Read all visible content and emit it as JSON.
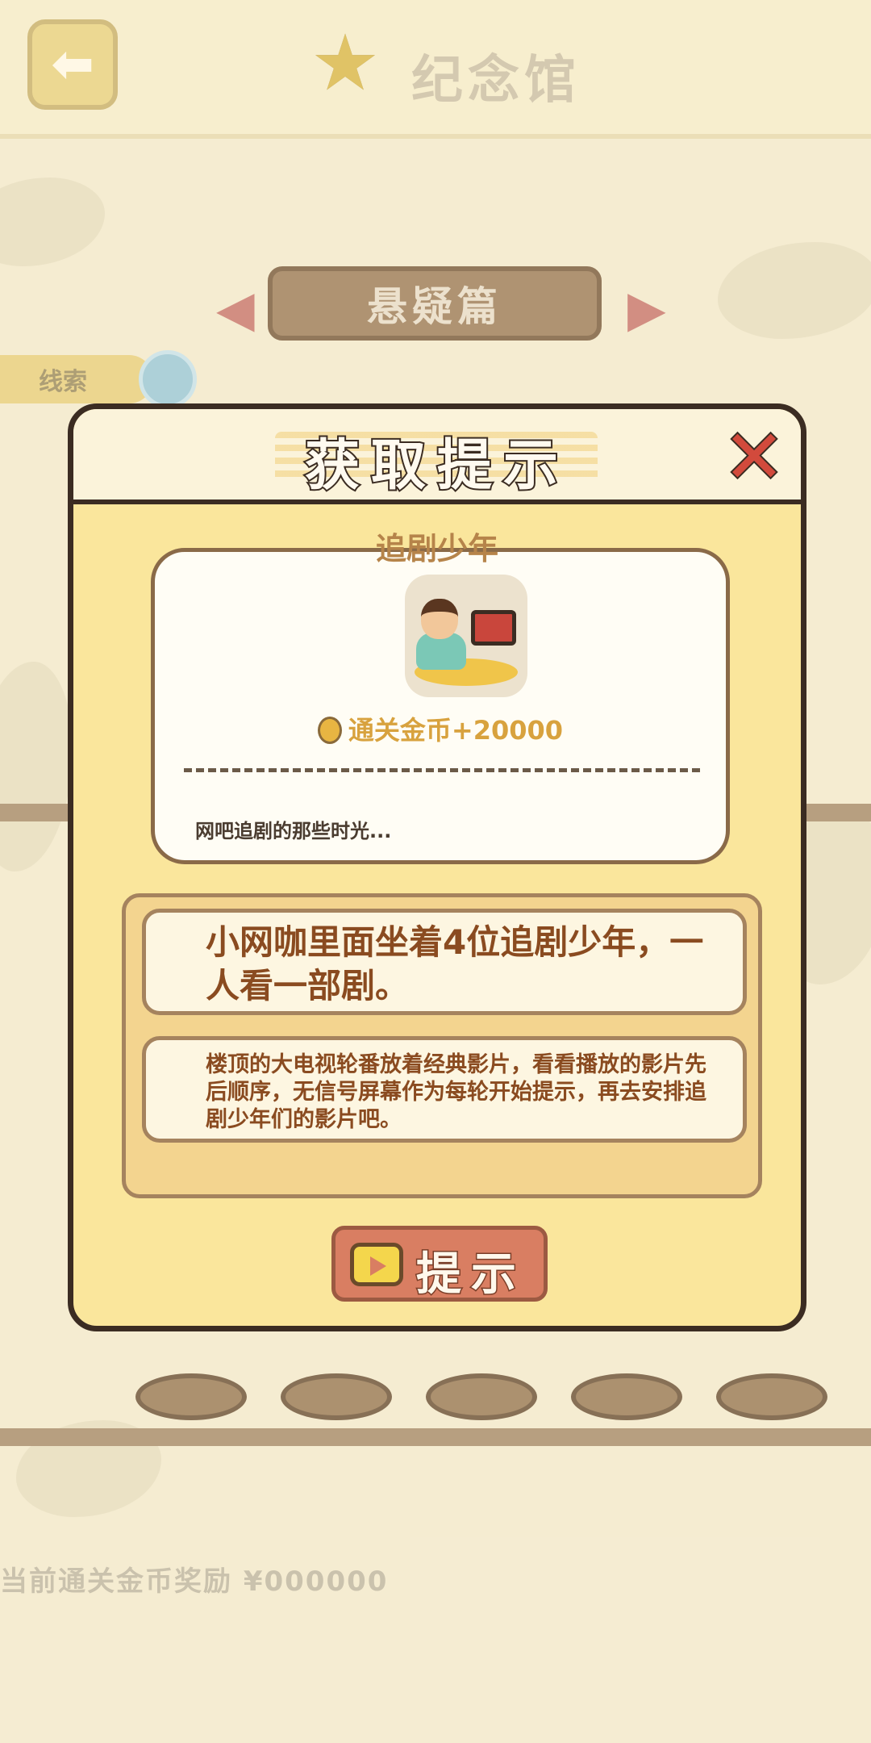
{
  "background": {
    "title": "纪念馆",
    "chapter": "悬疑篇",
    "side_tag": "线索",
    "bottom_text": "当前通关金币奖励 ¥000000"
  },
  "modal": {
    "title": "获取提示",
    "item_name": "追剧少年",
    "reward": "通关金币+20000",
    "description": "网吧追剧的那些时光...",
    "hint_main": "小网咖里面坐着4位追剧少年，一人看一部剧。",
    "hint_detail": "楼顶的大电视轮番放着经典影片，看看播放的影片先后顺序，无信号屏幕作为每轮开始提示，再去安排追剧少年们的影片吧。",
    "hint_button": "提示"
  },
  "icons": {
    "back": "back-arrow-icon",
    "close": "close-x-icon",
    "coin": "coin-icon",
    "video": "video-tv-icon"
  },
  "colors": {
    "modal_bg": "#fae69c",
    "border": "#3b2c22",
    "close_red": "#d24a3c",
    "button": "#d97e62",
    "hint_text": "#8a4b20"
  }
}
